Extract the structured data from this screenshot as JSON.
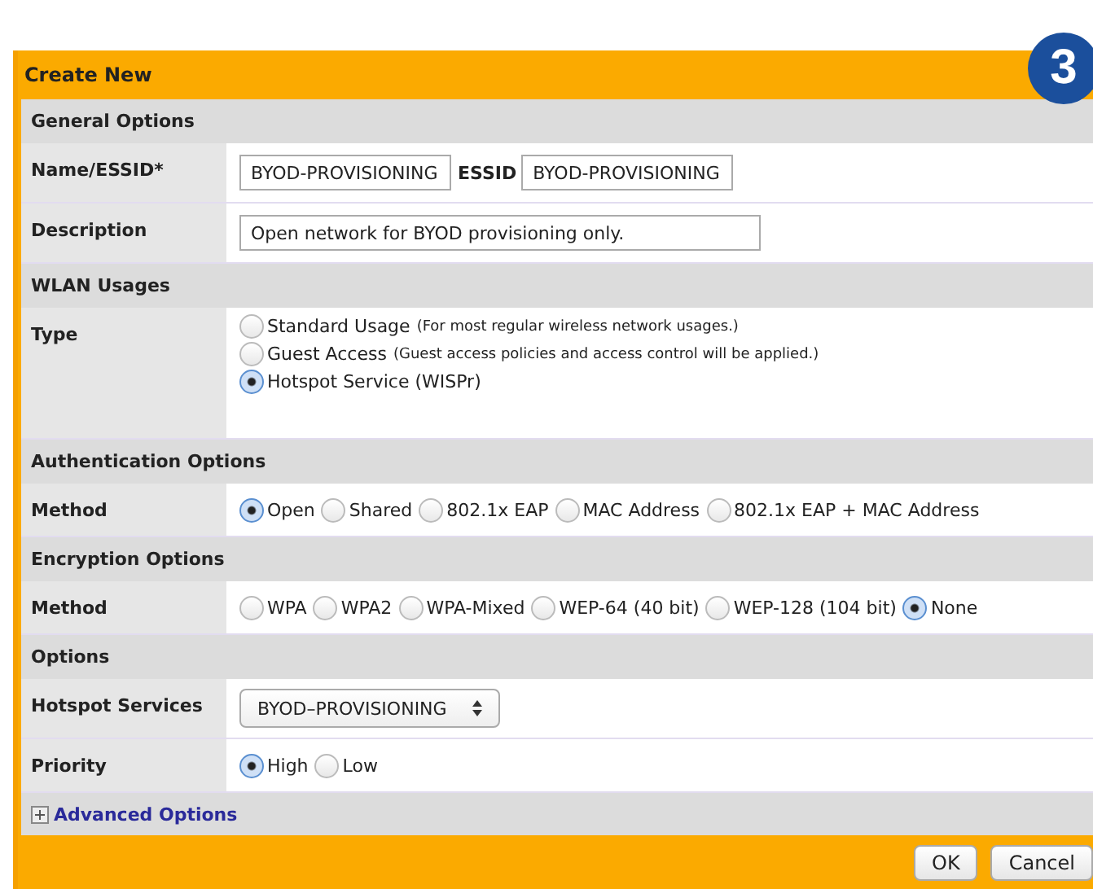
{
  "badge": "3",
  "title": "Create New",
  "rows": [
    {
      "kind": "section",
      "label": "General Options"
    },
    {
      "kind": "inputs",
      "label": "Name/ESSID*",
      "fields": [
        {
          "value": "BYOD-PROVISIONING"
        },
        {
          "caption": "ESSID",
          "value": "BYOD-PROVISIONING"
        }
      ]
    },
    {
      "kind": "inputs",
      "label": "Description",
      "fields": [
        {
          "value": "Open network for BYOD provisioning only.",
          "wide": true
        }
      ]
    },
    {
      "kind": "section",
      "label": "WLAN Usages"
    },
    {
      "kind": "stacked",
      "label": "Type",
      "options": [
        {
          "label": "Standard Usage",
          "note": "(For most regular wireless network usages.)",
          "selected": false
        },
        {
          "label": "Guest Access",
          "note": "(Guest access policies and access control will be applied.)",
          "selected": false
        },
        {
          "label": "Hotspot Service (WISPr)",
          "selected": true
        }
      ]
    },
    {
      "kind": "section",
      "label": "Authentication Options"
    },
    {
      "kind": "inline",
      "label": "Method",
      "options": [
        {
          "label": "Open",
          "selected": true
        },
        {
          "label": "Shared",
          "selected": false
        },
        {
          "label": "802.1x EAP",
          "selected": false
        },
        {
          "label": "MAC Address",
          "selected": false
        },
        {
          "label": "802.1x EAP + MAC Address",
          "selected": false
        }
      ]
    },
    {
      "kind": "section",
      "label": "Encryption Options"
    },
    {
      "kind": "inline",
      "label": "Method",
      "options": [
        {
          "label": "WPA",
          "selected": false
        },
        {
          "label": "WPA2",
          "selected": false
        },
        {
          "label": "WPA-Mixed",
          "selected": false
        },
        {
          "label": "WEP-64 (40 bit)",
          "selected": false
        },
        {
          "label": "WEP-128 (104 bit)",
          "selected": false
        },
        {
          "label": "None",
          "selected": true
        }
      ]
    },
    {
      "kind": "section",
      "label": "Options"
    },
    {
      "kind": "select",
      "label": "Hotspot Services",
      "value": "BYOD–PROVISIONING"
    },
    {
      "kind": "inline",
      "label": "Priority",
      "options": [
        {
          "label": "High",
          "selected": true
        },
        {
          "label": "Low",
          "selected": false
        }
      ]
    },
    {
      "kind": "expander",
      "label": "Advanced Options",
      "expanded": false
    }
  ],
  "buttons": [
    "OK",
    "Cancel"
  ]
}
